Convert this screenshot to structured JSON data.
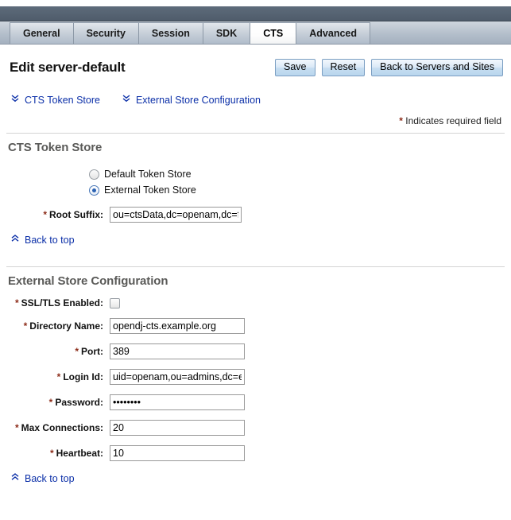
{
  "tabs": [
    {
      "label": "General",
      "active": false
    },
    {
      "label": "Security",
      "active": false
    },
    {
      "label": "Session",
      "active": false
    },
    {
      "label": "SDK",
      "active": false
    },
    {
      "label": "CTS",
      "active": true
    },
    {
      "label": "Advanced",
      "active": false
    }
  ],
  "header": {
    "title": "Edit server-default",
    "buttons": [
      {
        "label": "Save",
        "name": "save-button"
      },
      {
        "label": "Reset",
        "name": "reset-button"
      },
      {
        "label": "Back to Servers and Sites",
        "name": "back-to-servers-and-sites-button"
      }
    ]
  },
  "anchors": [
    {
      "label": "CTS Token Store",
      "icon": "double-chevron-down-icon"
    },
    {
      "label": "External Store Configuration",
      "icon": "double-chevron-down-icon"
    }
  ],
  "required_note": {
    "star": "*",
    "text": "Indicates required field"
  },
  "sections": [
    {
      "id": "cts-token-store",
      "title": "CTS Token Store",
      "radio_group": {
        "name": "token-store-type",
        "options": [
          {
            "label": "Default Token Store",
            "selected": false
          },
          {
            "label": "External Token Store",
            "selected": true
          }
        ]
      },
      "fields": [
        {
          "type": "text",
          "name": "root-suffix-field",
          "label": "Root Suffix:",
          "required": true,
          "value": "ou=ctsData,dc=openam,dc=fo"
        }
      ],
      "back_to_top": {
        "label": "Back to top",
        "icon": "double-chevron-up-icon"
      }
    },
    {
      "id": "external-store-configuration",
      "title": "External Store Configuration",
      "fields": [
        {
          "type": "checkbox",
          "name": "ssl-tls-enabled-checkbox",
          "label": "SSL/TLS Enabled:",
          "required": true,
          "checked": false
        },
        {
          "type": "text",
          "name": "directory-name-field",
          "label": "Directory Name:",
          "required": true,
          "value": "opendj-cts.example.org"
        },
        {
          "type": "text",
          "name": "port-field",
          "label": "Port:",
          "required": true,
          "value": "389"
        },
        {
          "type": "text",
          "name": "login-id-field",
          "label": "Login Id:",
          "required": true,
          "value": "uid=openam,ou=admins,dc=e"
        },
        {
          "type": "password",
          "name": "password-field",
          "label": "Password:",
          "required": true,
          "value": "••••••••"
        },
        {
          "type": "text",
          "name": "max-connections-field",
          "label": "Max Connections:",
          "required": true,
          "value": "20"
        },
        {
          "type": "text",
          "name": "heartbeat-field",
          "label": "Heartbeat:",
          "required": true,
          "value": "10"
        }
      ],
      "back_to_top": {
        "label": "Back to top",
        "icon": "double-chevron-up-icon"
      }
    }
  ],
  "colors": {
    "link": "#0b2fa8",
    "required_star": "#8c2b18",
    "section_heading": "#5a5a58",
    "tabbar_top": "#4f5c6b",
    "radio_selected": "#2b62b3"
  }
}
